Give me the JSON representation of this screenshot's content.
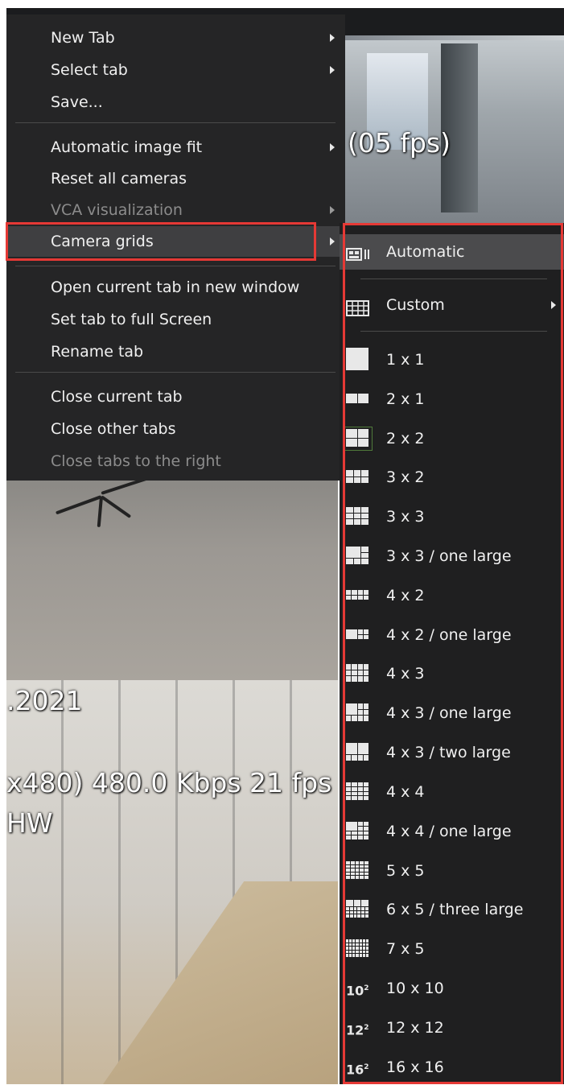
{
  "overlay": {
    "fps_top": "(05 fps)",
    "date_partial": ".2021",
    "stream_info": "x480) 480.0 Kbps 21 fps",
    "hw": "HW"
  },
  "menu": {
    "items": [
      {
        "label": "New Tab",
        "has_submenu": true,
        "enabled": true
      },
      {
        "label": "Select tab",
        "has_submenu": true,
        "enabled": true
      },
      {
        "label": "Save...",
        "has_submenu": false,
        "enabled": true
      },
      {
        "label": "Automatic image fit",
        "has_submenu": true,
        "enabled": true
      },
      {
        "label": "Reset all cameras",
        "has_submenu": false,
        "enabled": true
      },
      {
        "label": "VCA visualization",
        "has_submenu": true,
        "enabled": false
      },
      {
        "label": "Camera grids",
        "has_submenu": true,
        "enabled": true,
        "highlighted": true
      },
      {
        "label": "Open current tab in new window",
        "has_submenu": false,
        "enabled": true
      },
      {
        "label": "Set tab to full Screen",
        "has_submenu": false,
        "enabled": true
      },
      {
        "label": "Rename tab",
        "has_submenu": false,
        "enabled": true
      },
      {
        "label": "Close current tab",
        "has_submenu": false,
        "enabled": true
      },
      {
        "label": "Close other tabs",
        "has_submenu": false,
        "enabled": true
      },
      {
        "label": "Close tabs to the right",
        "has_submenu": false,
        "enabled": false
      }
    ]
  },
  "submenu": {
    "items": [
      {
        "label": "Automatic",
        "icon": "auto-grid-icon",
        "active": true
      },
      {
        "label": "Custom",
        "icon": "custom-grid-icon",
        "has_submenu": true
      },
      {
        "label": "1 x 1",
        "icon": "grid-1x1-icon"
      },
      {
        "label": "2 x 1",
        "icon": "grid-2x1-icon"
      },
      {
        "label": "2 x 2",
        "icon": "grid-2x2-icon"
      },
      {
        "label": "3 x 2",
        "icon": "grid-3x2-icon"
      },
      {
        "label": "3 x 3",
        "icon": "grid-3x3-icon"
      },
      {
        "label": "3 x 3 / one large",
        "icon": "grid-3x3-one-large-icon"
      },
      {
        "label": "4 x 2",
        "icon": "grid-4x2-icon"
      },
      {
        "label": "4 x 2 / one large",
        "icon": "grid-4x2-one-large-icon"
      },
      {
        "label": "4 x 3",
        "icon": "grid-4x3-icon"
      },
      {
        "label": "4 x 3 / one large",
        "icon": "grid-4x3-one-large-icon"
      },
      {
        "label": "4 x 3 / two large",
        "icon": "grid-4x3-two-large-icon"
      },
      {
        "label": "4 x 4",
        "icon": "grid-4x4-icon"
      },
      {
        "label": "4 x 4 / one large",
        "icon": "grid-4x4-one-large-icon"
      },
      {
        "label": "5 x 5",
        "icon": "grid-5x5-icon"
      },
      {
        "label": "6 x 5 / three large",
        "icon": "grid-6x5-three-large-icon"
      },
      {
        "label": "7 x 5",
        "icon": "grid-7x5-icon"
      },
      {
        "label": "10 x 10",
        "icon": "grid-10x10-icon",
        "icon_text": "10",
        "icon_sup": "2"
      },
      {
        "label": "12 x 12",
        "icon": "grid-12x12-icon",
        "icon_text": "12",
        "icon_sup": "2"
      },
      {
        "label": "16 x 16",
        "icon": "grid-16x16-icon",
        "icon_text": "16",
        "icon_sup": "2"
      }
    ]
  },
  "colors": {
    "highlight_border": "#e53935",
    "menu_bg": "#252526",
    "submenu_bg": "#1f1f20",
    "active_bg": "#4b4b4d"
  }
}
